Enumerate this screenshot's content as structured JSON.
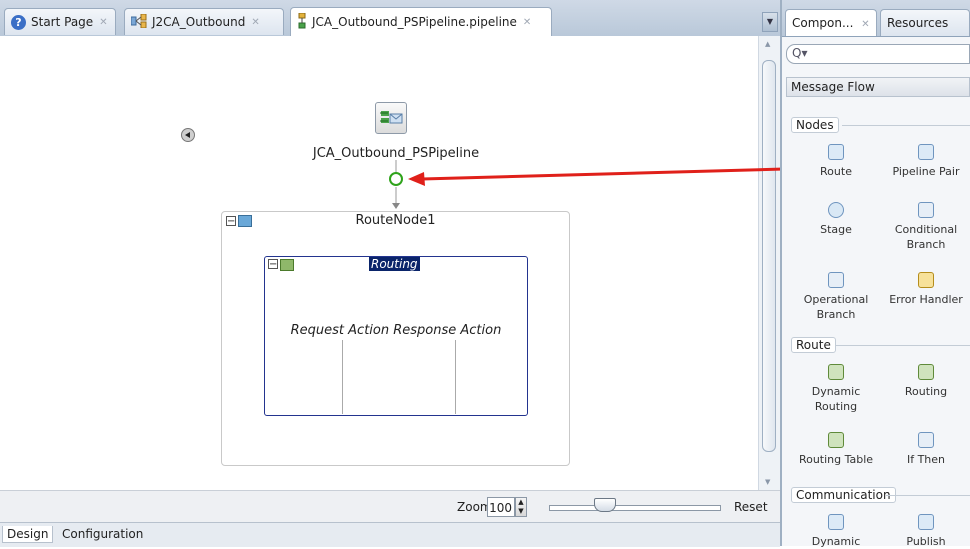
{
  "editor_tabs": [
    {
      "label": "Start Page",
      "icon": "help-icon"
    },
    {
      "label": "J2CA_Outbound",
      "icon": "composite-icon"
    },
    {
      "label": "JCA_Outbound_PSPipeline.pipeline",
      "icon": "pipeline-icon"
    }
  ],
  "canvas": {
    "pipeline_label": "JCA_Outbound_PSPipeline",
    "route_node_label": "RouteNode1",
    "routing_label": "Routing",
    "routing_actions": "Request Action Response Action",
    "arrow_color": "#e0201a",
    "start_circle_color": "#2fa31b"
  },
  "zoom": {
    "label": "Zoom:",
    "value": "100",
    "reset_label": "Reset",
    "slider_fraction": 0.3
  },
  "bottom_tabs": [
    {
      "label": "Design"
    },
    {
      "label": "Configuration"
    }
  ],
  "palette": {
    "tabs": [
      {
        "label": "Compon..."
      },
      {
        "label": "Resources"
      }
    ],
    "search_placeholder": "",
    "category": "Message Flow",
    "sections": {
      "nodes": {
        "title": "Nodes",
        "items": [
          {
            "label": "Route",
            "icon": "route-icon"
          },
          {
            "label": "Pipeline Pair",
            "icon": "pipeline-pair-icon"
          },
          {
            "label": "Stage",
            "icon": "stage-icon"
          },
          {
            "label": "Conditional Branch",
            "icon": "conditional-branch-icon"
          },
          {
            "label": "Operational Branch",
            "icon": "operational-branch-icon"
          },
          {
            "label": "Error Handler",
            "icon": "error-handler-icon"
          }
        ]
      },
      "route": {
        "title": "Route",
        "items": [
          {
            "label": "Dynamic Routing",
            "icon": "dynamic-routing-icon"
          },
          {
            "label": "Routing",
            "icon": "routing-icon"
          },
          {
            "label": "Routing Table",
            "icon": "routing-table-icon"
          },
          {
            "label": "If Then",
            "icon": "if-then-icon"
          }
        ]
      },
      "communication": {
        "title": "Communication",
        "items": [
          {
            "label": "Dynamic",
            "icon": "dynamic-publish-icon"
          },
          {
            "label": "Publish",
            "icon": "publish-icon"
          }
        ]
      }
    }
  }
}
